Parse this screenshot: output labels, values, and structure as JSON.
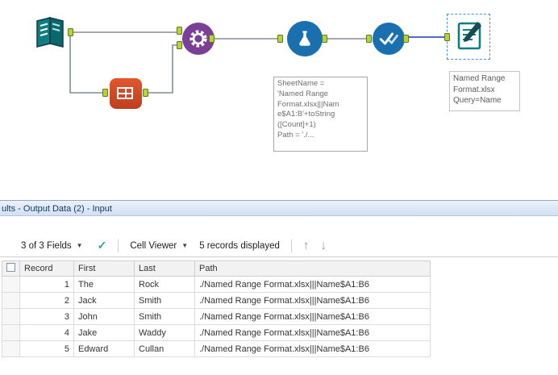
{
  "workflow": {
    "tools": {
      "input_data": {
        "name": "Input Data"
      },
      "text_input": {
        "name": "Text Input"
      },
      "macro": {
        "name": "Macro"
      },
      "formula": {
        "name": "Formula"
      },
      "check": {
        "name": "Select"
      },
      "output_data": {
        "name": "Output Data"
      }
    },
    "annotations": {
      "flask_lines": [
        "SheetName =",
        "'Named Range",
        "Format.xlsx|||Nam",
        "e$A1:B'+toString",
        "([Count]+1)",
        "Path = './..."
      ],
      "output_lines": [
        "Named Range",
        "Format.xlsx",
        "Query=Name"
      ]
    }
  },
  "results": {
    "title": "ults - Output Data (2) - Input",
    "toolbar": {
      "fields_dropdown": "3 of 3 Fields",
      "cell_viewer_dropdown": "Cell Viewer",
      "records_text": "5 records displayed",
      "check_icon": "✓",
      "chevron": "▼",
      "up_arrow": "↑",
      "down_arrow": "↓"
    },
    "table": {
      "columns": [
        "Record",
        "First",
        "Last",
        "Path"
      ],
      "rows": [
        [
          "1",
          "The",
          "Rock",
          "./Named Range Format.xlsx|||Name$A1:B6"
        ],
        [
          "2",
          "Jack",
          "Smith",
          "./Named Range Format.xlsx|||Name$A1:B6"
        ],
        [
          "3",
          "John",
          "Smith",
          "./Named Range Format.xlsx|||Name$A1:B6"
        ],
        [
          "4",
          "Jake",
          "Waddy",
          "./Named Range Format.xlsx|||Name$A1:B6"
        ],
        [
          "5",
          "Edward",
          "Cullan",
          "./Named Range Format.xlsx|||Name$A1:B6"
        ]
      ]
    }
  },
  "colors": {
    "anchor_green": "#B5D334",
    "selected_connection": "#3E53C6",
    "tool_purple": "#7C3F97",
    "tool_blue": "#1A6FAE",
    "tool_orange": "#DD4F27",
    "tool_teal": "#0E7E83"
  }
}
